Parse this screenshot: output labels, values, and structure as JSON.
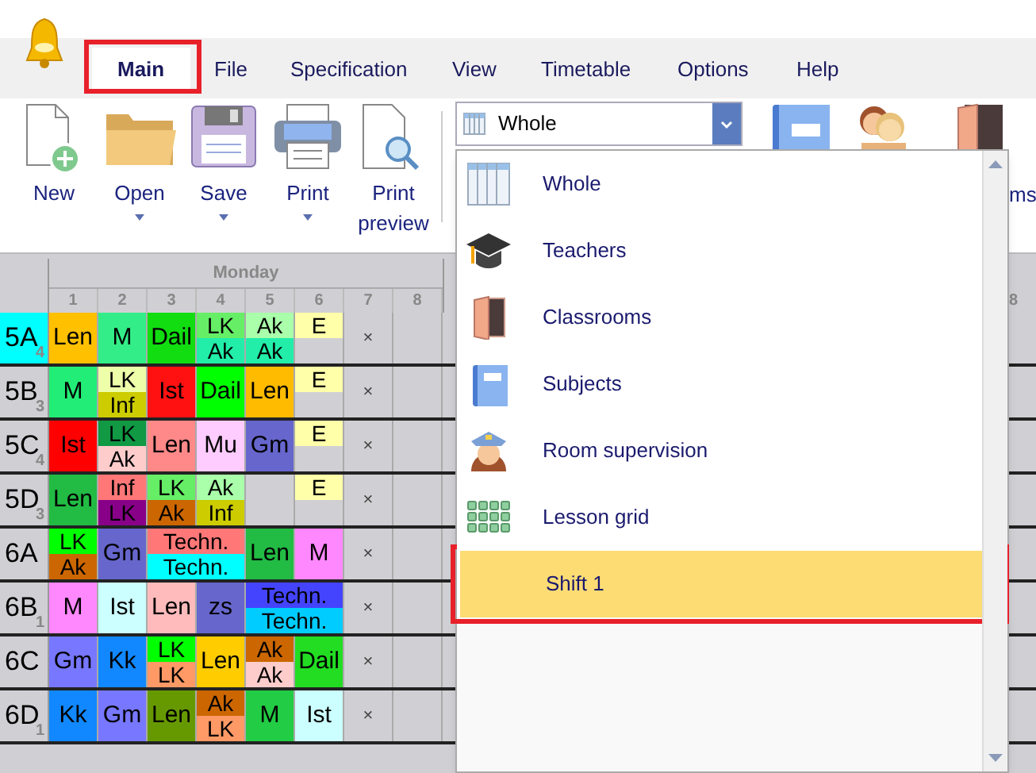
{
  "menu_tabs": [
    {
      "label": "Main",
      "selected": true,
      "highlighted": true
    },
    {
      "label": "File",
      "selected": false,
      "highlighted": false
    },
    {
      "label": "Specification",
      "selected": false,
      "highlighted": false
    },
    {
      "label": "View",
      "selected": false,
      "highlighted": false
    },
    {
      "label": "Timetable",
      "selected": false,
      "highlighted": false
    },
    {
      "label": "Options",
      "selected": false,
      "highlighted": false
    },
    {
      "label": "Help",
      "selected": false,
      "highlighted": false
    }
  ],
  "ribbon": {
    "buttons": [
      {
        "label": "New",
        "kind": "new",
        "dropdown": false
      },
      {
        "label": "Open",
        "kind": "open",
        "dropdown": true
      },
      {
        "label": "Save",
        "kind": "save",
        "dropdown": true
      },
      {
        "label": "Print",
        "kind": "print",
        "dropdown": true
      },
      {
        "label": "Print preview",
        "kind": "preview",
        "dropdown": false
      }
    ],
    "view_combo": {
      "value": "Whole"
    },
    "cut_label": "ms"
  },
  "dropdown": {
    "items": [
      {
        "label": "Whole",
        "kind": "whole",
        "selected": false,
        "highlighted": false
      },
      {
        "label": "Teachers",
        "kind": "teachers",
        "selected": false,
        "highlighted": false
      },
      {
        "label": "Classrooms",
        "kind": "classrooms",
        "selected": false,
        "highlighted": false
      },
      {
        "label": "Subjects",
        "kind": "subjects",
        "selected": false,
        "highlighted": false
      },
      {
        "label": "Room supervision",
        "kind": "supervision",
        "selected": false,
        "highlighted": false
      },
      {
        "label": "Lesson grid",
        "kind": "grid",
        "selected": false,
        "highlighted": false
      },
      {
        "label": "Shift 1",
        "kind": "none",
        "selected": true,
        "highlighted": true
      }
    ]
  },
  "timetable": {
    "day": "Monday",
    "periods": [
      "1",
      "2",
      "3",
      "4",
      "5",
      "6",
      "7",
      "8"
    ],
    "right_edge_period": "8",
    "rows": [
      {
        "class": "5A",
        "count": "4",
        "selected": true,
        "cells": [
          {
            "kind": "single",
            "text": "Len",
            "color": "#ffc000"
          },
          {
            "kind": "single",
            "text": "M",
            "color": "#33ee88"
          },
          {
            "kind": "single",
            "text": "Dail",
            "color": "#11dd11"
          },
          {
            "kind": "split",
            "top": {
              "text": "LK",
              "color": "#66ee66"
            },
            "bottom": {
              "text": "Ak",
              "color": "#22eeaa"
            }
          },
          {
            "kind": "split",
            "top": {
              "text": "Ak",
              "color": "#aaffaa"
            },
            "bottom": {
              "text": "Ak",
              "color": "#22eeaa"
            }
          },
          {
            "kind": "half",
            "text": "E",
            "color": "#ffffaa"
          },
          {
            "kind": "mark",
            "text": "×"
          },
          {
            "kind": "empty"
          }
        ]
      },
      {
        "class": "5B",
        "count": "3",
        "selected": false,
        "cells": [
          {
            "kind": "single",
            "text": "M",
            "color": "#22ee77"
          },
          {
            "kind": "split",
            "top": {
              "text": "LK",
              "color": "#eeffaa"
            },
            "bottom": {
              "text": "Inf",
              "color": "#cccc00"
            }
          },
          {
            "kind": "single",
            "text": "Ist",
            "color": "#ff1111"
          },
          {
            "kind": "single",
            "text": "Dail",
            "color": "#00ff00"
          },
          {
            "kind": "single",
            "text": "Len",
            "color": "#ffbb00"
          },
          {
            "kind": "half",
            "text": "E",
            "color": "#ffffaa"
          },
          {
            "kind": "mark",
            "text": "×"
          },
          {
            "kind": "empty"
          }
        ]
      },
      {
        "class": "5C",
        "count": "4",
        "selected": false,
        "cells": [
          {
            "kind": "single",
            "text": "Ist",
            "color": "#ff0000"
          },
          {
            "kind": "split",
            "top": {
              "text": "LK",
              "color": "#119944"
            },
            "bottom": {
              "text": "Ak",
              "color": "#ffcccc"
            }
          },
          {
            "kind": "single",
            "text": "Len",
            "color": "#ff8888"
          },
          {
            "kind": "single",
            "text": "Mu",
            "color": "#ffccff"
          },
          {
            "kind": "single",
            "text": "Gm",
            "color": "#6666cc"
          },
          {
            "kind": "half",
            "text": "E",
            "color": "#ffffaa"
          },
          {
            "kind": "mark",
            "text": "×"
          },
          {
            "kind": "empty"
          }
        ]
      },
      {
        "class": "5D",
        "count": "3",
        "selected": false,
        "cells": [
          {
            "kind": "single",
            "text": "Len",
            "color": "#22bb44"
          },
          {
            "kind": "split",
            "top": {
              "text": "Inf",
              "color": "#ff7777"
            },
            "bottom": {
              "text": "LK",
              "color": "#880088"
            }
          },
          {
            "kind": "split",
            "top": {
              "text": "LK",
              "color": "#66ee66"
            },
            "bottom": {
              "text": "Ak",
              "color": "#cc6600"
            }
          },
          {
            "kind": "split",
            "top": {
              "text": "Ak",
              "color": "#aaffaa"
            },
            "bottom": {
              "text": "Inf",
              "color": "#cccc00"
            }
          },
          {
            "kind": "empty"
          },
          {
            "kind": "half",
            "text": "E",
            "color": "#ffffaa"
          },
          {
            "kind": "mark",
            "text": "×"
          },
          {
            "kind": "empty"
          }
        ]
      },
      {
        "class": "6A",
        "selected": false,
        "cells": [
          {
            "kind": "split",
            "top": {
              "text": "LK",
              "color": "#00ff00"
            },
            "bottom": {
              "text": "Ak",
              "color": "#cc6600"
            }
          },
          {
            "kind": "single",
            "text": "Gm",
            "color": "#6666cc"
          },
          {
            "kind": "wide_split",
            "top": {
              "text": "Techn.",
              "color": "#ff7777"
            },
            "bottom": {
              "text": "Techn.",
              "color": "#00ffff"
            }
          },
          "",
          {
            "kind": "single",
            "text": "Len",
            "color": "#22bb44"
          },
          {
            "kind": "single",
            "text": "M",
            "color": "#ff88ff"
          },
          {
            "kind": "mark",
            "text": "×"
          },
          {
            "kind": "empty"
          }
        ]
      },
      {
        "class": "6B",
        "count": "1",
        "selected": false,
        "cells": [
          {
            "kind": "single",
            "text": "M",
            "color": "#ff88ff"
          },
          {
            "kind": "single",
            "text": "Ist",
            "color": "#ccffff"
          },
          {
            "kind": "single",
            "text": "Len",
            "color": "#ffbbbb"
          },
          {
            "kind": "single",
            "text": "zs",
            "color": "#6666cc"
          },
          {
            "kind": "wide_split",
            "top": {
              "text": "Techn.",
              "color": "#4444ff"
            },
            "bottom": {
              "text": "Techn.",
              "color": "#00ccff"
            }
          },
          "",
          {
            "kind": "mark",
            "text": "×"
          },
          {
            "kind": "empty"
          }
        ]
      },
      {
        "class": "6C",
        "selected": false,
        "cells": [
          {
            "kind": "single",
            "text": "Gm",
            "color": "#7777ff"
          },
          {
            "kind": "single",
            "text": "Kk",
            "color": "#1188ff"
          },
          {
            "kind": "split",
            "top": {
              "text": "LK",
              "color": "#00ff00"
            },
            "bottom": {
              "text": "LK",
              "color": "#ff9966"
            }
          },
          {
            "kind": "single",
            "text": "Len",
            "color": "#ffcc00"
          },
          {
            "kind": "split",
            "top": {
              "text": "Ak",
              "color": "#cc6600"
            },
            "bottom": {
              "text": "Ak",
              "color": "#ffcccc"
            }
          },
          {
            "kind": "single",
            "text": "Dail",
            "color": "#22dd22"
          },
          {
            "kind": "mark",
            "text": "×"
          },
          {
            "kind": "empty"
          }
        ]
      },
      {
        "class": "6D",
        "count": "1",
        "selected": false,
        "cells": [
          {
            "kind": "single",
            "text": "Kk",
            "color": "#1188ff"
          },
          {
            "kind": "single",
            "text": "Gm",
            "color": "#7777ff"
          },
          {
            "kind": "single",
            "text": "Len",
            "color": "#669900"
          },
          {
            "kind": "split",
            "top": {
              "text": "Ak",
              "color": "#cc6600"
            },
            "bottom": {
              "text": "LK",
              "color": "#ff9966"
            }
          },
          {
            "kind": "single",
            "text": "M",
            "color": "#22cc44"
          },
          {
            "kind": "single",
            "text": "Ist",
            "color": "#ccffff"
          },
          {
            "kind": "mark",
            "text": "×"
          },
          {
            "kind": "empty"
          }
        ]
      }
    ]
  }
}
